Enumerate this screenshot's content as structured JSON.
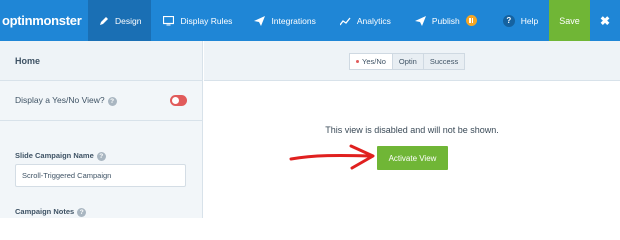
{
  "topbar": {
    "logo": "optinmonster",
    "nav": [
      {
        "label": "Design",
        "icon": "pencil-icon"
      },
      {
        "label": "Display Rules",
        "icon": "monitor-icon"
      },
      {
        "label": "Integrations",
        "icon": "paper-plane-icon"
      },
      {
        "label": "Analytics",
        "icon": "chart-icon"
      },
      {
        "label": "Publish",
        "icon": "send-icon"
      },
      {
        "label": "Help",
        "icon": "question-icon"
      }
    ],
    "save_label": "Save",
    "close_glyph": "✖"
  },
  "sidebar": {
    "heading": "Home",
    "yes_no_label": "Display a Yes/No View?",
    "campaign_name_label": "Slide Campaign Name",
    "campaign_name_value": "Scroll-Triggered Campaign",
    "campaign_notes_label": "Campaign Notes"
  },
  "main": {
    "tabs": [
      "Yes/No",
      "Optin",
      "Success"
    ],
    "message": "This view is disabled and will not be shown.",
    "activate_label": "Activate View"
  },
  "colors": {
    "brand_blue": "#1f86d6",
    "active_blue": "#1a6fb4",
    "green": "#70b636",
    "toggle_red": "#e15b5b",
    "arrow_red": "#e0201f"
  }
}
